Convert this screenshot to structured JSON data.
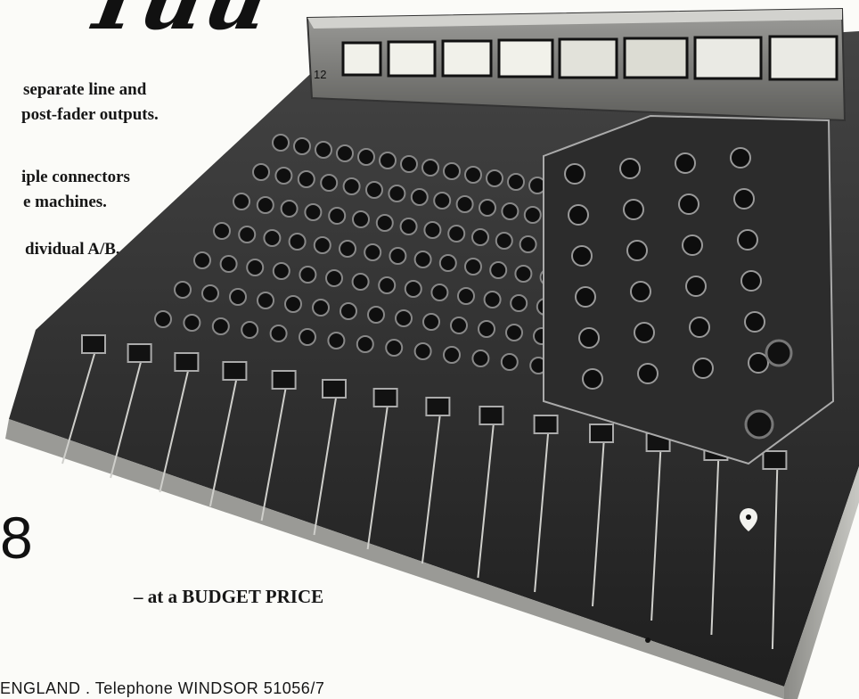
{
  "headline": {
    "script_fragment": "Tuu"
  },
  "features": [
    {
      "lines": [
        "separate line and",
        "post-fader outputs."
      ]
    },
    {
      "lines": [
        "iple connectors",
        "e machines."
      ]
    },
    {
      "lines": [
        "dividual A/B,"
      ]
    }
  ],
  "product": {
    "model_number_fragment": "8",
    "tagline": "– at a BUDGET PRICE",
    "meter_panel_label": "12"
  },
  "contact": {
    "address_fragment": "ENGLAND . Telephone WINDSOR 51056/7"
  },
  "photo": {
    "subject": "mixing-console",
    "channel_strip_count": 14,
    "meter_count": 8,
    "colors": {
      "chassis": "#2a2a2a",
      "panel": "#3b3b3b",
      "trim": "#b9b9b6",
      "meter_face": "#e9e9e2"
    }
  }
}
